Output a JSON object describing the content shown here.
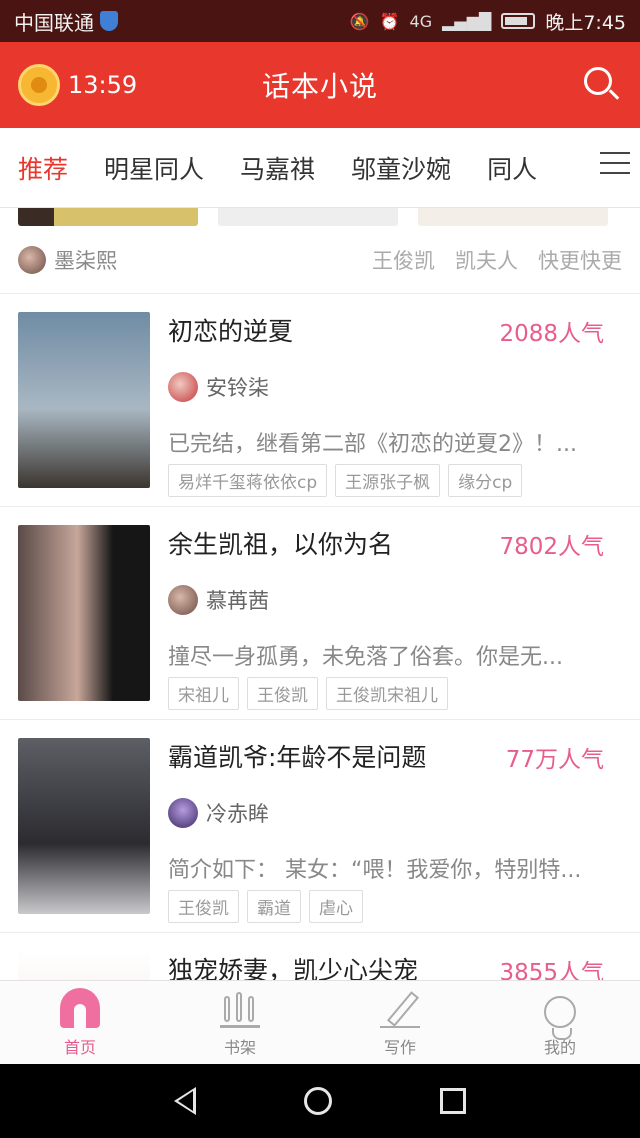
{
  "status_bar": {
    "carrier": "中国联通",
    "time": "晚上7:45",
    "network": "4G"
  },
  "header": {
    "timer": "13:59",
    "title": "话本小说"
  },
  "tabs": [
    "推荐",
    "明星同人",
    "马嘉祺",
    "邬童沙婉",
    "同人"
  ],
  "author_row": {
    "name": "墨柒熙",
    "tags": [
      "王俊凯",
      "凯夫人",
      "快更快更"
    ]
  },
  "books": [
    {
      "title": "初恋的逆夏",
      "popularity": "2088人气",
      "author": "安铃柒",
      "desc": "已完结，继看第二部《初恋的逆夏2》！...",
      "tags": [
        "易烊千玺蒋依依cp",
        "王源张子枫",
        "缘分cp"
      ]
    },
    {
      "title": "余生凯祖，以你为名",
      "popularity": "7802人气",
      "author": "慕苒茜",
      "desc": "撞尽一身孤勇，未免落了俗套。你是无...",
      "tags": [
        "宋祖儿",
        "王俊凯",
        "王俊凯宋祖儿"
      ]
    },
    {
      "title": "霸道凯爷:年龄不是问题",
      "popularity": "77万人气",
      "author": "冷赤眸",
      "desc": "简介如下：  某女：“喂！我爱你，特别特...",
      "tags": [
        "王俊凯",
        "霸道",
        "虐心"
      ]
    },
    {
      "title": "独宠娇妻，凯少心尖宠",
      "popularity": "3855人气"
    }
  ],
  "bottom_nav": [
    "首页",
    "书架",
    "写作",
    "我的"
  ],
  "colors": {
    "header": "#e8382d",
    "accent_pink": "#e85c8e",
    "status_bar": "#4a1412"
  }
}
